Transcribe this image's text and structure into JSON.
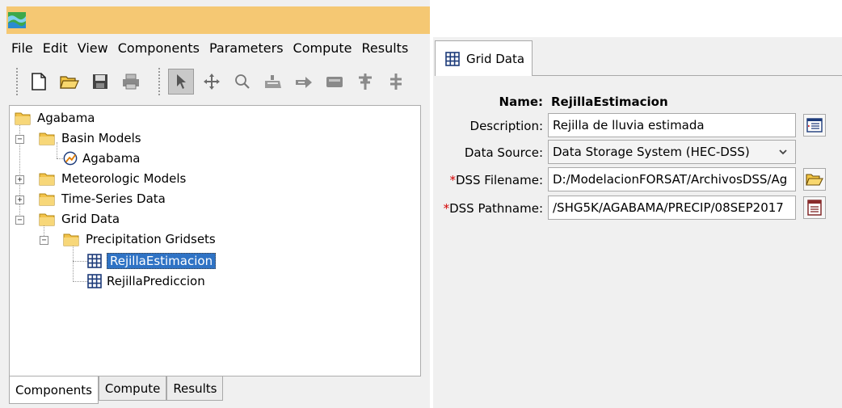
{
  "menubar": [
    "File",
    "Edit",
    "View",
    "Components",
    "Parameters",
    "Compute",
    "Results"
  ],
  "toolbar_icons": [
    "new-file-icon",
    "open-folder-icon",
    "save-icon",
    "print-icon",
    "select-arrow-icon",
    "pan-icon",
    "zoom-icon",
    "add-subbasin-icon",
    "add-reach-icon",
    "add-reservoir-icon",
    "add-junction-icon",
    "add-diversion-icon"
  ],
  "tree": {
    "root": "Agabama",
    "basin_models": "Basin Models",
    "basin_model_item": "Agabama",
    "meteorologic_models": "Meteorologic Models",
    "time_series": "Time-Series Data",
    "grid_data": "Grid Data",
    "precip_gridsets": "Precipitation Gridsets",
    "grid_item_1": "RejillaEstimacion",
    "grid_item_2": "RejillaPrediccion"
  },
  "bottom_tabs": [
    "Components",
    "Compute",
    "Results"
  ],
  "editor": {
    "tab_label": "Grid Data",
    "name_label": "Name:",
    "name_value": "RejillaEstimacion",
    "description_label": "Description:",
    "description_value": "Rejilla de lluvia estimada",
    "data_source_label": "Data Source:",
    "data_source_value": "Data Storage System (HEC-DSS)",
    "required_mark": "*",
    "dss_filename_label": "DSS Filename:",
    "dss_filename_value": "D:/ModelacionFORSAT/ArchivosDSS/Ag",
    "dss_pathname_label": "DSS Pathname:",
    "dss_pathname_value": "/SHG5K/AGABAMA/PRECIP/08SEP2017"
  },
  "colors": {
    "title_bar": "#f5c873",
    "selection": "#2f73c5",
    "required": "#d40000"
  }
}
